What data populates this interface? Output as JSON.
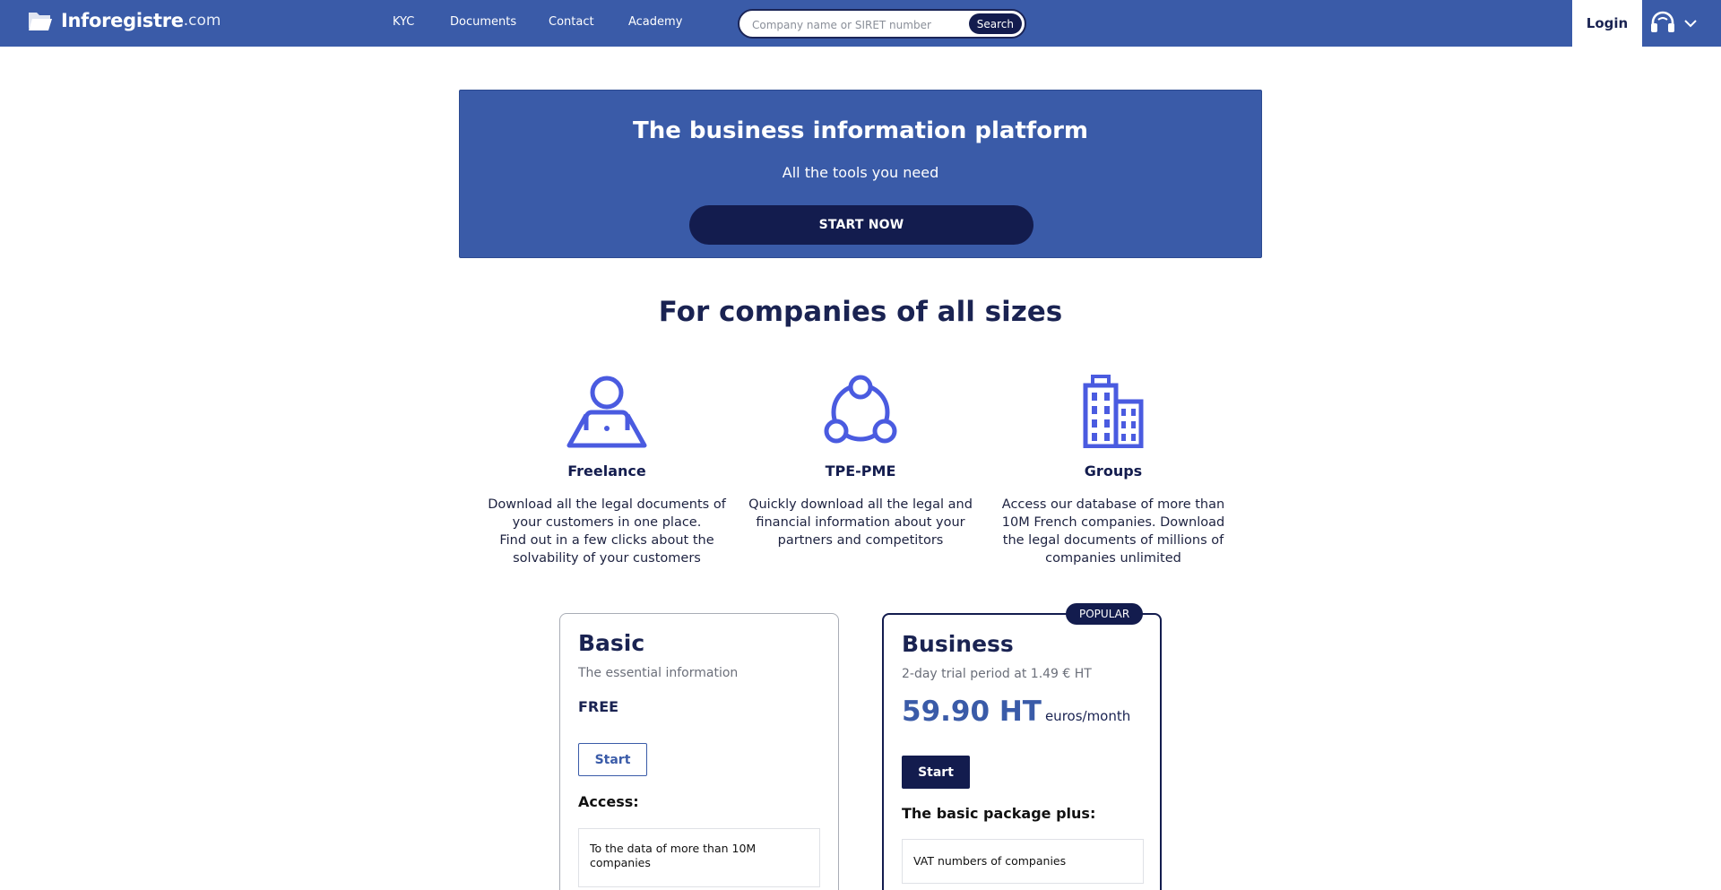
{
  "header": {
    "logo_name": "Inforegistre",
    "logo_domain": ".com",
    "nav": [
      "KYC",
      "Documents",
      "Contact",
      "Academy"
    ],
    "search_placeholder": "Company name or SIRET number",
    "search_button": "Search",
    "login": "Login"
  },
  "hero": {
    "title": "The business information platform",
    "subtitle": "All the tools you need",
    "cta": "START NOW"
  },
  "sizes": {
    "title": "For companies of all sizes",
    "items": [
      {
        "icon": "freelancer-laptop-icon",
        "title": "Freelance",
        "desc": "Download all the legal documents of your customers in one place.\nFind out in a few clicks about the solvability of your customers"
      },
      {
        "icon": "network-icon",
        "title": "TPE-PME",
        "desc": "Quickly download all the legal and financial information about your partners and competitors"
      },
      {
        "icon": "buildings-icon",
        "title": "Groups",
        "desc": "Access our database of more than 10M French companies. Download the legal documents of millions of companies unlimited"
      }
    ]
  },
  "pricing": {
    "basic": {
      "name": "Basic",
      "tagline": "The essential information",
      "price": "FREE",
      "button": "Start",
      "section": "Access:",
      "features": [
        "To the data of more than 10M companies"
      ]
    },
    "business": {
      "badge": "POPULAR",
      "name": "Business",
      "tagline": "2-day trial period at 1.49 € HT",
      "price": "59.90 HT",
      "price_unit": "euros/month",
      "button": "Start",
      "section": "The basic package plus:",
      "features": [
        "VAT numbers of companies"
      ]
    }
  },
  "colors": {
    "header_bg": "#3a5ba8",
    "navy": "#131c4e",
    "icon_blue": "#4a5be0"
  }
}
